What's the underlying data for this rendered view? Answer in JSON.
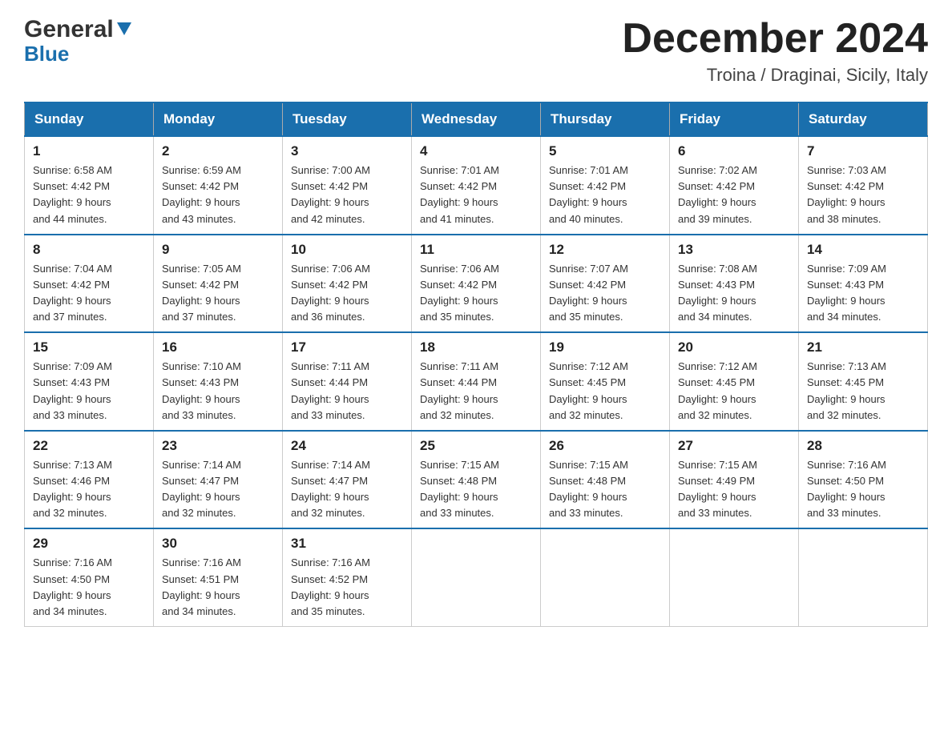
{
  "logo": {
    "name": "General",
    "name2": "Blue",
    "subtitle": "Blue"
  },
  "header": {
    "month_year": "December 2024",
    "location": "Troina / Draginai, Sicily, Italy"
  },
  "days_of_week": [
    "Sunday",
    "Monday",
    "Tuesday",
    "Wednesday",
    "Thursday",
    "Friday",
    "Saturday"
  ],
  "weeks": [
    [
      {
        "day": "1",
        "sunrise": "6:58 AM",
        "sunset": "4:42 PM",
        "daylight": "9 hours and 44 minutes."
      },
      {
        "day": "2",
        "sunrise": "6:59 AM",
        "sunset": "4:42 PM",
        "daylight": "9 hours and 43 minutes."
      },
      {
        "day": "3",
        "sunrise": "7:00 AM",
        "sunset": "4:42 PM",
        "daylight": "9 hours and 42 minutes."
      },
      {
        "day": "4",
        "sunrise": "7:01 AM",
        "sunset": "4:42 PM",
        "daylight": "9 hours and 41 minutes."
      },
      {
        "day": "5",
        "sunrise": "7:01 AM",
        "sunset": "4:42 PM",
        "daylight": "9 hours and 40 minutes."
      },
      {
        "day": "6",
        "sunrise": "7:02 AM",
        "sunset": "4:42 PM",
        "daylight": "9 hours and 39 minutes."
      },
      {
        "day": "7",
        "sunrise": "7:03 AM",
        "sunset": "4:42 PM",
        "daylight": "9 hours and 38 minutes."
      }
    ],
    [
      {
        "day": "8",
        "sunrise": "7:04 AM",
        "sunset": "4:42 PM",
        "daylight": "9 hours and 37 minutes."
      },
      {
        "day": "9",
        "sunrise": "7:05 AM",
        "sunset": "4:42 PM",
        "daylight": "9 hours and 37 minutes."
      },
      {
        "day": "10",
        "sunrise": "7:06 AM",
        "sunset": "4:42 PM",
        "daylight": "9 hours and 36 minutes."
      },
      {
        "day": "11",
        "sunrise": "7:06 AM",
        "sunset": "4:42 PM",
        "daylight": "9 hours and 35 minutes."
      },
      {
        "day": "12",
        "sunrise": "7:07 AM",
        "sunset": "4:42 PM",
        "daylight": "9 hours and 35 minutes."
      },
      {
        "day": "13",
        "sunrise": "7:08 AM",
        "sunset": "4:43 PM",
        "daylight": "9 hours and 34 minutes."
      },
      {
        "day": "14",
        "sunrise": "7:09 AM",
        "sunset": "4:43 PM",
        "daylight": "9 hours and 34 minutes."
      }
    ],
    [
      {
        "day": "15",
        "sunrise": "7:09 AM",
        "sunset": "4:43 PM",
        "daylight": "9 hours and 33 minutes."
      },
      {
        "day": "16",
        "sunrise": "7:10 AM",
        "sunset": "4:43 PM",
        "daylight": "9 hours and 33 minutes."
      },
      {
        "day": "17",
        "sunrise": "7:11 AM",
        "sunset": "4:44 PM",
        "daylight": "9 hours and 33 minutes."
      },
      {
        "day": "18",
        "sunrise": "7:11 AM",
        "sunset": "4:44 PM",
        "daylight": "9 hours and 32 minutes."
      },
      {
        "day": "19",
        "sunrise": "7:12 AM",
        "sunset": "4:45 PM",
        "daylight": "9 hours and 32 minutes."
      },
      {
        "day": "20",
        "sunrise": "7:12 AM",
        "sunset": "4:45 PM",
        "daylight": "9 hours and 32 minutes."
      },
      {
        "day": "21",
        "sunrise": "7:13 AM",
        "sunset": "4:45 PM",
        "daylight": "9 hours and 32 minutes."
      }
    ],
    [
      {
        "day": "22",
        "sunrise": "7:13 AM",
        "sunset": "4:46 PM",
        "daylight": "9 hours and 32 minutes."
      },
      {
        "day": "23",
        "sunrise": "7:14 AM",
        "sunset": "4:47 PM",
        "daylight": "9 hours and 32 minutes."
      },
      {
        "day": "24",
        "sunrise": "7:14 AM",
        "sunset": "4:47 PM",
        "daylight": "9 hours and 32 minutes."
      },
      {
        "day": "25",
        "sunrise": "7:15 AM",
        "sunset": "4:48 PM",
        "daylight": "9 hours and 33 minutes."
      },
      {
        "day": "26",
        "sunrise": "7:15 AM",
        "sunset": "4:48 PM",
        "daylight": "9 hours and 33 minutes."
      },
      {
        "day": "27",
        "sunrise": "7:15 AM",
        "sunset": "4:49 PM",
        "daylight": "9 hours and 33 minutes."
      },
      {
        "day": "28",
        "sunrise": "7:16 AM",
        "sunset": "4:50 PM",
        "daylight": "9 hours and 33 minutes."
      }
    ],
    [
      {
        "day": "29",
        "sunrise": "7:16 AM",
        "sunset": "4:50 PM",
        "daylight": "9 hours and 34 minutes."
      },
      {
        "day": "30",
        "sunrise": "7:16 AM",
        "sunset": "4:51 PM",
        "daylight": "9 hours and 34 minutes."
      },
      {
        "day": "31",
        "sunrise": "7:16 AM",
        "sunset": "4:52 PM",
        "daylight": "9 hours and 35 minutes."
      },
      null,
      null,
      null,
      null
    ]
  ]
}
